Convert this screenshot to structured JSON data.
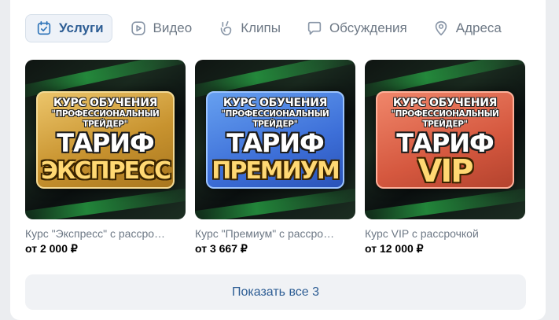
{
  "tabs": [
    {
      "label": "Услуги",
      "icon": "calendar-check-icon",
      "active": true
    },
    {
      "label": "Видео",
      "icon": "play-icon",
      "active": false
    },
    {
      "label": "Клипы",
      "icon": "clips-icon",
      "active": false
    },
    {
      "label": "Обсуждения",
      "icon": "chat-icon",
      "active": false
    },
    {
      "label": "Адреса",
      "icon": "location-pin-icon",
      "active": false
    }
  ],
  "products": [
    {
      "title": "Курс \"Экспресс\" с рассро…",
      "price": "от 2 000 ₽",
      "image": {
        "line1": "КУРС ОБУЧЕНИЯ",
        "line2": "\"ПРОФЕССИОНАЛЬНЫЙ ТРЕЙДЕР\"",
        "line3": "ТАРИФ",
        "line4": "ЭКСПРЕСС",
        "color": "#c8932f"
      }
    },
    {
      "title": "Курс \"Премиум\" с рассро…",
      "price": "от 3 667 ₽",
      "image": {
        "line1": "КУРС ОБУЧЕНИЯ",
        "line2": "\"ПРОФЕССИОНАЛЬНЫЙ ТРЕЙДЕР\"",
        "line3": "ТАРИФ",
        "line4": "ПРЕМИУМ",
        "color": "#3d6fd8"
      }
    },
    {
      "title": "Курс VIP с рассрочкой",
      "price": "от 12 000 ₽",
      "image": {
        "line1": "КУРС ОБУЧЕНИЯ",
        "line2": "\"ПРОФЕССИОНАЛЬНЫЙ ТРЕЙДЕР\"",
        "line3": "ТАРИФ",
        "line4": "VIP",
        "color": "#d5583f"
      }
    }
  ],
  "show_all": {
    "label": "Показать все 3"
  },
  "colors": {
    "accent": "#2d5d94",
    "muted": "#6d7885",
    "background": "#ebedf0"
  }
}
